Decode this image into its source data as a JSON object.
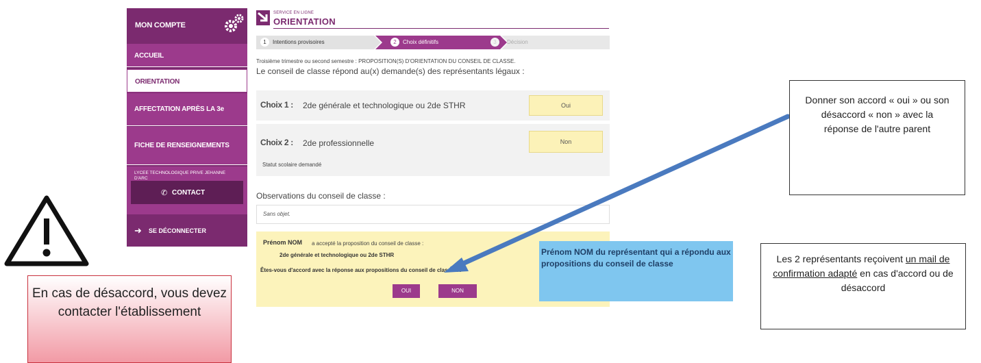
{
  "sidebar": {
    "account_label": "MON COMPTE",
    "items": [
      {
        "label": "ACCUEIL"
      },
      {
        "label": "ORIENTATION"
      },
      {
        "label": "AFFECTATION APRÈS LA 3e"
      },
      {
        "label": "FICHE DE RENSEIGNEMENTS"
      }
    ],
    "school": "LYCEE TECHNOLOGIQUE PRIVE JEHANNE D'ARC",
    "contact_label": "CONTACT",
    "logout_label": "SE DÉCONNECTER"
  },
  "header": {
    "service_label": "SERVICE EN LIGNE",
    "title": "ORIENTATION"
  },
  "stepper": [
    {
      "num": "1",
      "label": "Intentions provisoires"
    },
    {
      "num": "2",
      "label": "Choix définitifs"
    },
    {
      "num": "3",
      "label": "Décision"
    }
  ],
  "main": {
    "period_text": "Troisième trimestre ou second semestre : PROPOSITION(S) D'ORIENTATION DU CONSEIL DE CLASSE.",
    "intro": "Le conseil de classe répond au(x) demande(s) des représentants légaux :",
    "choices": [
      {
        "label": "Choix 1 :",
        "value": "2de générale et technologique ou 2de STHR",
        "answer": "Oui"
      },
      {
        "label": "Choix 2 :",
        "value": "2de professionnelle",
        "answer": "Non",
        "status": "Statut scolaire demandé"
      }
    ],
    "observations_label": "Observations du conseil de classe :",
    "observations_value": "Sans objet.",
    "parent_name": "Prénom NOM",
    "accepted_text": "a accepté la proposition du conseil de classe :",
    "accepted_value": "2de générale et technologique ou 2de STHR",
    "question": "Êtes-vous d'accord avec la réponse aux propositions du conseil de classe de",
    "oui_label": "OUI",
    "non_label": "NON"
  },
  "annotations": {
    "right_box": "Donner son accord « oui » ou son désaccord « non » avec la réponse de l'autre parent",
    "blue_box": "Prénom NOM du représentant qui a répondu aux propositions du conseil de classe",
    "bottom_right_pre": "Les 2 représentants reçoivent",
    "bottom_right_link": "un mail de confirmation adapté",
    "bottom_right_post": "en cas d'accord ou de désaccord",
    "warning": "En cas de désaccord, vous devez contacter l'établissement"
  },
  "colors": {
    "brand": "#7b2a6f",
    "accent": "#9c3a8c",
    "arrow": "#4a7abf"
  }
}
